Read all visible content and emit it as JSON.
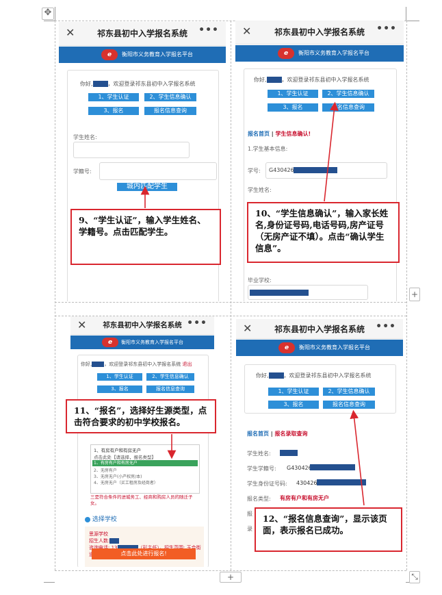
{
  "page": {
    "move_handle": "✥",
    "add_handle": "+",
    "resize_handle": "⤡"
  },
  "colors": {
    "accent": "#2d8fd8",
    "banner": "#1f6db5",
    "callout_border": "#d9262e",
    "link_red": "#c8102e"
  },
  "app": {
    "title": "祁东县初中入学报名系统",
    "close": "✕",
    "more": "•••",
    "banner_text": "衡阳市义务教育入学报名平台"
  },
  "menu": {
    "auth": "1、学生认证",
    "confirm": "2、学生信息确认",
    "register": "3、报名",
    "query": "报名信息查询"
  },
  "welcome": {
    "prefix": "你好,",
    "suffix": "，欢迎登录祁东县初中入学报名系统",
    "logout": "退出"
  },
  "p1": {
    "name_label": "学生姓名:",
    "id_label": "学籍号:",
    "match_button": "城内匹配学生",
    "callout": "9、“学生认证”，输入学生姓名、学籍号。点击匹配学生。"
  },
  "p2": {
    "breadcrumb_home": "报名首页",
    "breadcrumb_sep": " | ",
    "breadcrumb_current": "学生信息确认!",
    "section": "1.学生基本信息:",
    "id_label": "学号:",
    "id_value": "G430426",
    "name_label": "学生姓名:",
    "school_label": "毕业学校:",
    "callout": "10、“学生信息确认”，输入家长姓名,身份证号码,电话号码,房产证号（无房产证不填）。点击“确认学生信息”。"
  },
  "p3": {
    "dropdown_title": "1、有房有户和有房无户",
    "dropdown_hint": "点击此处【请选择，报名类型】",
    "options": [
      "1、有房有户和有房无户",
      "2、无房有户",
      "3、无房无户(小产权房/本)",
      "4、无房无户（买工租房及经商者）"
    ],
    "warning": "三是符合条件的进城务工、经商和购房人员的随迁子女。",
    "choose_school": "选择学校",
    "school_name": "思源学校",
    "quota_label": "招生人数:",
    "phone_label": "咨询电话: 13",
    "phone_suffix": "（彭主任），招生范围: 玉合街道办事处辖区。",
    "go_button": "点击此处进行报名!",
    "callout": "11、“报名”，选择好生源类型，点击符合要求的初中学校报名。"
  },
  "p4": {
    "breadcrumb_home": "报名首页",
    "breadcrumb_sep": " | ",
    "breadcrumb_current": "报名录取查询",
    "name_label": "学生姓名:",
    "id_label": "学生学籍号:",
    "id_value": "G430426",
    "idcard_label": "学生身份证号码:",
    "idcard_value": "430426",
    "type_label": "报名类型:",
    "type_value": "有房有户和有房无户",
    "trunc1": "报",
    "trunc2": "录",
    "callout": "12、“报名信息查询”，显示该页面，表示报名已成功。"
  }
}
